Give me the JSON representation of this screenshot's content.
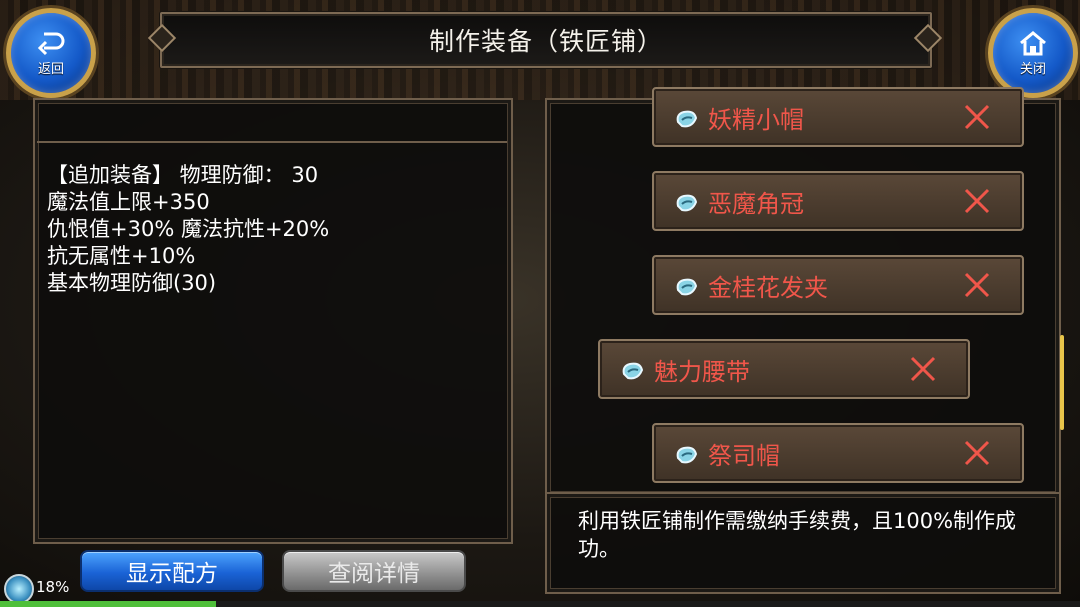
{
  "header": {
    "title": "制作装备（铁匠铺）",
    "back_label": "返回",
    "close_label": "关闭"
  },
  "stats": {
    "lines": [
      "【追加装备】 物理防御：  30",
      "魔法值上限+350",
      "仇恨值+30% 魔法抗性+20%",
      "抗无属性+10%",
      "基本物理防御(30)"
    ]
  },
  "recipes": {
    "items": [
      {
        "name": "妖精小帽",
        "selected": false
      },
      {
        "name": "恶魔角冠",
        "selected": false
      },
      {
        "name": "金桂花发夹",
        "selected": false
      },
      {
        "name": "魅力腰带",
        "selected": true
      },
      {
        "name": "祭司帽",
        "selected": false
      }
    ],
    "name_color": "#f0564a",
    "remove_icon": "close-x-icon",
    "item_icon": "scroll-icon"
  },
  "description": "利用铁匠铺制作需缴纳手续费，且100%制作成功。",
  "buttons": {
    "show_recipe": "显示配方",
    "view_details": "查阅详情"
  },
  "status": {
    "percent_label": "18%",
    "exp_fraction": 0.2
  },
  "colors": {
    "accent_blue": "#1a63d6",
    "frame_gold": "#c9a14a",
    "item_name_red": "#f0564a"
  }
}
